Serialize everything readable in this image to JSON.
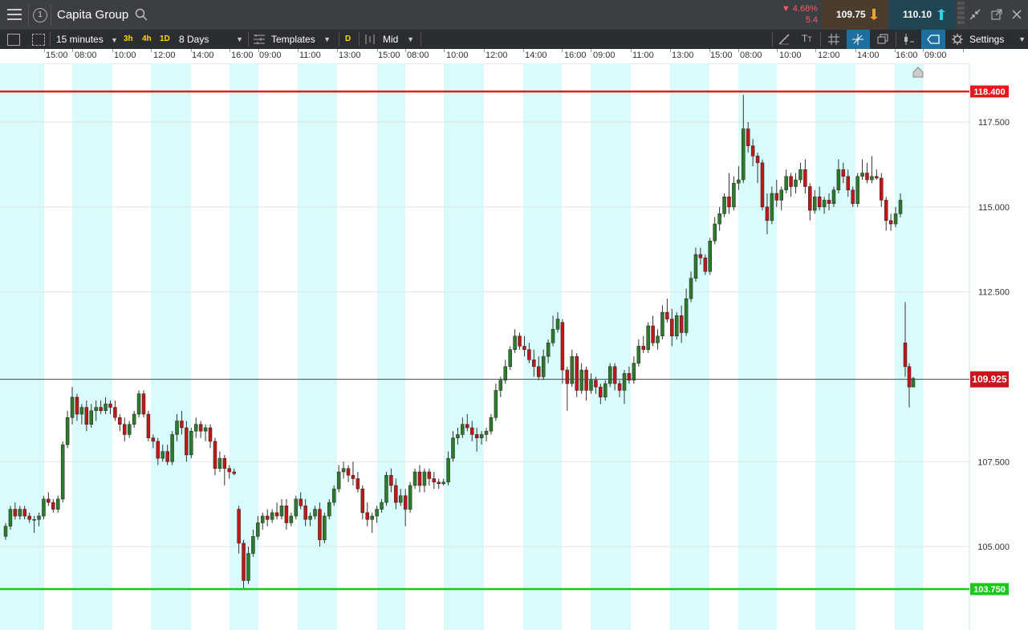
{
  "header": {
    "instrument": "Capita Group",
    "change_pct": "▼ 4.68%",
    "change_abs": "5.4",
    "sell_price": "109.75",
    "buy_price": "110.10",
    "colors": {
      "down": "#ff5a5a",
      "sell_bg": "#4a3a2a",
      "buy_bg": "#1e4a5a",
      "arrow_sell": "#f0a030",
      "arrow_buy": "#3cc8e8"
    }
  },
  "toolbar": {
    "interval": "15 minutes",
    "quick_ranges": [
      "3h",
      "4h",
      "1D"
    ],
    "period": "8 Days",
    "templates": "Templates",
    "d_label": "D",
    "price_type": "Mid",
    "settings": "Settings"
  },
  "chart_data": {
    "type": "candlestick",
    "x_tick_labels": [
      "15:00",
      "08:00",
      "10:00",
      "12:00",
      "14:00",
      "16:00",
      "09:00",
      "11:00",
      "13:00",
      "15:00",
      "08:00",
      "10:00",
      "12:00",
      "14:00",
      "16:00",
      "09:00",
      "11:00",
      "13:00",
      "15:00",
      "08:00",
      "10:00",
      "12:00",
      "14:00",
      "16:00",
      "09:00"
    ],
    "y_tick_labels": [
      "117.500",
      "115.000",
      "112.500",
      "107.500",
      "105.000"
    ],
    "y_ticks": [
      117.5,
      115.0,
      112.5,
      107.5,
      105.0
    ],
    "ylim": [
      102.6,
      119.2
    ],
    "horizontal_lines": [
      {
        "value": 118.4,
        "label": "118.400",
        "color": "#e8191e"
      },
      {
        "value": 109.925,
        "label": "109.925",
        "color": "#444444",
        "box_color": "#c8161d"
      },
      {
        "value": 103.75,
        "label": "103.750",
        "color": "#19c819"
      }
    ],
    "colors": {
      "up": "#2d7a2d",
      "down": "#c01818",
      "session_band": "#d9fbfc"
    },
    "candles": [
      [
        105.3,
        105.7,
        105.2,
        105.6
      ],
      [
        105.6,
        106.2,
        105.5,
        106.1
      ],
      [
        106.1,
        106.3,
        105.8,
        105.9
      ],
      [
        105.9,
        106.2,
        105.8,
        106.1
      ],
      [
        106.1,
        106.2,
        105.8,
        105.9
      ],
      [
        105.9,
        106.0,
        105.7,
        105.8
      ],
      [
        105.8,
        105.9,
        105.4,
        105.8
      ],
      [
        105.8,
        106.0,
        105.6,
        105.9
      ],
      [
        105.9,
        106.5,
        105.8,
        106.4
      ],
      [
        106.4,
        106.6,
        106.2,
        106.3
      ],
      [
        106.3,
        106.4,
        106.0,
        106.1
      ],
      [
        106.1,
        106.5,
        106.0,
        106.4
      ],
      [
        106.4,
        108.1,
        106.3,
        108.0
      ],
      [
        108.0,
        109.0,
        107.9,
        108.8
      ],
      [
        108.8,
        109.7,
        108.6,
        109.4
      ],
      [
        109.4,
        109.5,
        108.7,
        108.9
      ],
      [
        108.9,
        109.2,
        108.6,
        109.1
      ],
      [
        109.1,
        109.3,
        108.4,
        108.6
      ],
      [
        108.6,
        109.2,
        108.5,
        109.0
      ],
      [
        109.0,
        109.3,
        108.7,
        109.1
      ],
      [
        109.1,
        109.3,
        108.9,
        109.0
      ],
      [
        109.0,
        109.4,
        108.9,
        109.2
      ],
      [
        109.2,
        109.3,
        108.9,
        109.1
      ],
      [
        109.1,
        109.3,
        108.7,
        108.8
      ],
      [
        108.8,
        108.9,
        108.4,
        108.6
      ],
      [
        108.6,
        108.8,
        108.1,
        108.3
      ],
      [
        108.3,
        108.7,
        108.2,
        108.6
      ],
      [
        108.6,
        109.0,
        108.5,
        108.9
      ],
      [
        108.9,
        109.6,
        108.8,
        109.5
      ],
      [
        109.5,
        109.6,
        108.8,
        108.9
      ],
      [
        108.9,
        109.0,
        108.1,
        108.2
      ],
      [
        108.2,
        108.3,
        107.9,
        108.1
      ],
      [
        108.1,
        108.2,
        107.4,
        107.6
      ],
      [
        107.6,
        108.0,
        107.5,
        107.8
      ],
      [
        107.8,
        108.0,
        107.4,
        107.5
      ],
      [
        107.5,
        108.4,
        107.4,
        108.3
      ],
      [
        108.3,
        108.9,
        108.1,
        108.7
      ],
      [
        108.7,
        109.0,
        108.3,
        108.5
      ],
      [
        108.5,
        108.7,
        107.5,
        107.7
      ],
      [
        107.7,
        108.5,
        107.6,
        108.4
      ],
      [
        108.4,
        108.8,
        108.2,
        108.6
      ],
      [
        108.6,
        108.7,
        108.2,
        108.4
      ],
      [
        108.4,
        108.6,
        108.1,
        108.5
      ],
      [
        108.5,
        108.6,
        107.9,
        108.1
      ],
      [
        108.1,
        108.2,
        107.1,
        107.3
      ],
      [
        107.3,
        107.8,
        107.2,
        107.6
      ],
      [
        107.6,
        107.7,
        106.8,
        107.3
      ],
      [
        107.3,
        107.4,
        107.0,
        107.2
      ],
      [
        107.2,
        107.3,
        107.1,
        107.15
      ],
      [
        106.1,
        106.2,
        104.8,
        105.1
      ],
      [
        105.1,
        105.2,
        103.75,
        104.0
      ],
      [
        104.0,
        105.0,
        103.9,
        104.8
      ],
      [
        104.8,
        105.5,
        104.7,
        105.3
      ],
      [
        105.3,
        105.9,
        105.2,
        105.7
      ],
      [
        105.7,
        106.0,
        105.5,
        105.9
      ],
      [
        105.9,
        106.1,
        105.6,
        105.8
      ],
      [
        105.8,
        106.1,
        105.7,
        106.0
      ],
      [
        106.0,
        106.3,
        105.8,
        105.9
      ],
      [
        105.9,
        106.4,
        105.8,
        106.2
      ],
      [
        106.2,
        106.4,
        105.5,
        105.7
      ],
      [
        105.7,
        106.0,
        105.6,
        105.9
      ],
      [
        105.9,
        106.5,
        105.8,
        106.4
      ],
      [
        106.4,
        106.6,
        106.1,
        106.2
      ],
      [
        106.2,
        106.4,
        105.6,
        105.8
      ],
      [
        105.8,
        106.0,
        105.6,
        105.9
      ],
      [
        105.9,
        106.2,
        105.8,
        106.1
      ],
      [
        106.1,
        106.3,
        105.0,
        105.2
      ],
      [
        105.2,
        106.0,
        105.1,
        105.9
      ],
      [
        105.9,
        106.4,
        105.8,
        106.3
      ],
      [
        106.3,
        106.8,
        106.2,
        106.7
      ],
      [
        106.7,
        107.4,
        106.6,
        107.2
      ],
      [
        107.2,
        107.5,
        107.0,
        107.3
      ],
      [
        107.3,
        107.4,
        106.9,
        107.1
      ],
      [
        107.1,
        107.5,
        106.8,
        107.0
      ],
      [
        107.0,
        107.2,
        106.6,
        106.7
      ],
      [
        106.7,
        106.8,
        105.8,
        106.0
      ],
      [
        106.0,
        106.3,
        105.6,
        105.8
      ],
      [
        105.8,
        106.0,
        105.4,
        105.9
      ],
      [
        105.9,
        106.2,
        105.7,
        106.1
      ],
      [
        106.1,
        106.4,
        106.0,
        106.3
      ],
      [
        106.3,
        107.2,
        106.2,
        107.1
      ],
      [
        107.1,
        107.3,
        106.6,
        106.8
      ],
      [
        106.8,
        107.0,
        106.1,
        106.3
      ],
      [
        106.3,
        106.7,
        106.2,
        106.5
      ],
      [
        106.5,
        106.7,
        105.6,
        106.1
      ],
      [
        106.1,
        106.9,
        106.0,
        106.8
      ],
      [
        106.8,
        107.3,
        106.7,
        107.2
      ],
      [
        107.2,
        107.4,
        106.6,
        106.8
      ],
      [
        106.8,
        107.3,
        106.6,
        107.2
      ],
      [
        107.2,
        107.3,
        106.8,
        107.0
      ],
      [
        107.0,
        107.2,
        106.7,
        106.9
      ],
      [
        106.9,
        107.0,
        106.7,
        106.85
      ],
      [
        106.85,
        107.0,
        106.8,
        106.9
      ],
      [
        106.9,
        107.8,
        106.8,
        107.6
      ],
      [
        107.6,
        108.4,
        107.5,
        108.2
      ],
      [
        108.2,
        108.5,
        108.0,
        108.3
      ],
      [
        108.3,
        108.8,
        108.2,
        108.6
      ],
      [
        108.6,
        108.9,
        108.4,
        108.5
      ],
      [
        108.5,
        108.7,
        108.1,
        108.3
      ],
      [
        108.3,
        108.5,
        107.8,
        108.2
      ],
      [
        108.2,
        108.4,
        108.0,
        108.3
      ],
      [
        108.3,
        108.5,
        108.1,
        108.4
      ],
      [
        108.4,
        108.9,
        108.3,
        108.8
      ],
      [
        108.8,
        109.8,
        108.7,
        109.6
      ],
      [
        109.6,
        110.0,
        109.4,
        109.9
      ],
      [
        109.9,
        110.5,
        109.8,
        110.3
      ],
      [
        110.3,
        110.9,
        110.2,
        110.8
      ],
      [
        110.8,
        111.4,
        110.7,
        111.2
      ],
      [
        111.2,
        111.3,
        110.8,
        110.9
      ],
      [
        110.9,
        111.2,
        110.6,
        110.8
      ],
      [
        110.8,
        111.0,
        110.4,
        110.5
      ],
      [
        110.5,
        110.8,
        110.0,
        110.3
      ],
      [
        110.3,
        110.6,
        109.9,
        110.0
      ],
      [
        110.0,
        110.8,
        109.9,
        110.6
      ],
      [
        110.6,
        111.1,
        110.4,
        111.0
      ],
      [
        111.0,
        111.8,
        110.9,
        111.4
      ],
      [
        111.4,
        111.9,
        111.3,
        111.7
      ],
      [
        111.6,
        111.7,
        109.8,
        110.2
      ],
      [
        110.2,
        110.3,
        109.0,
        109.8
      ],
      [
        109.8,
        110.8,
        109.7,
        110.6
      ],
      [
        110.6,
        110.7,
        109.4,
        109.6
      ],
      [
        109.6,
        110.4,
        109.5,
        110.2
      ],
      [
        110.2,
        110.3,
        109.3,
        109.6
      ],
      [
        109.6,
        110.1,
        109.5,
        109.9
      ],
      [
        109.9,
        110.0,
        109.5,
        109.7
      ],
      [
        109.7,
        109.8,
        109.2,
        109.4
      ],
      [
        109.4,
        109.9,
        109.3,
        109.8
      ],
      [
        109.8,
        110.4,
        109.7,
        110.3
      ],
      [
        110.3,
        110.4,
        109.6,
        109.8
      ],
      [
        109.8,
        109.9,
        109.4,
        109.6
      ],
      [
        109.6,
        110.2,
        109.2,
        110.1
      ],
      [
        110.1,
        110.3,
        109.8,
        109.9
      ],
      [
        109.9,
        110.6,
        109.8,
        110.4
      ],
      [
        110.4,
        111.1,
        110.3,
        110.9
      ],
      [
        110.9,
        111.2,
        110.7,
        110.8
      ],
      [
        110.8,
        111.6,
        110.7,
        111.5
      ],
      [
        111.5,
        111.8,
        110.9,
        111.0
      ],
      [
        111.0,
        111.4,
        110.8,
        111.2
      ],
      [
        111.2,
        112.1,
        111.1,
        111.9
      ],
      [
        111.9,
        112.3,
        111.6,
        111.7
      ],
      [
        111.7,
        112.0,
        110.9,
        111.2
      ],
      [
        111.2,
        111.9,
        111.1,
        111.8
      ],
      [
        111.8,
        112.1,
        111.0,
        111.3
      ],
      [
        111.3,
        112.6,
        111.2,
        112.3
      ],
      [
        112.3,
        113.1,
        112.2,
        112.9
      ],
      [
        112.9,
        113.8,
        112.8,
        113.6
      ],
      [
        113.6,
        113.8,
        113.3,
        113.5
      ],
      [
        113.5,
        113.6,
        113.0,
        113.1
      ],
      [
        113.1,
        114.1,
        113.0,
        114.0
      ],
      [
        114.0,
        114.7,
        113.9,
        114.5
      ],
      [
        114.5,
        115.0,
        114.3,
        114.8
      ],
      [
        114.8,
        115.4,
        114.7,
        115.3
      ],
      [
        115.3,
        116.0,
        114.8,
        115.0
      ],
      [
        115.0,
        115.9,
        114.9,
        115.7
      ],
      [
        115.7,
        116.2,
        115.5,
        115.8
      ],
      [
        115.8,
        118.3,
        115.7,
        117.3
      ],
      [
        117.3,
        117.5,
        116.6,
        116.8
      ],
      [
        116.8,
        117.0,
        116.2,
        116.5
      ],
      [
        116.5,
        116.6,
        115.7,
        116.3
      ],
      [
        116.3,
        116.4,
        114.9,
        115.0
      ],
      [
        115.0,
        115.4,
        114.2,
        114.6
      ],
      [
        114.6,
        115.6,
        114.5,
        115.4
      ],
      [
        115.4,
        115.8,
        115.0,
        115.2
      ],
      [
        115.2,
        115.6,
        114.9,
        115.5
      ],
      [
        115.5,
        116.1,
        115.4,
        115.9
      ],
      [
        115.9,
        116.0,
        115.3,
        115.6
      ],
      [
        115.6,
        116.0,
        115.4,
        115.8
      ],
      [
        115.8,
        116.3,
        115.7,
        116.1
      ],
      [
        116.1,
        116.4,
        115.4,
        115.6
      ],
      [
        115.6,
        115.7,
        114.6,
        114.9
      ],
      [
        114.9,
        115.5,
        114.8,
        115.3
      ],
      [
        115.3,
        115.6,
        114.9,
        115.0
      ],
      [
        115.0,
        115.3,
        114.8,
        115.2
      ],
      [
        115.2,
        115.4,
        114.9,
        115.1
      ],
      [
        115.1,
        115.6,
        115.0,
        115.5
      ],
      [
        115.5,
        116.4,
        115.4,
        116.1
      ],
      [
        116.1,
        116.3,
        115.7,
        115.9
      ],
      [
        115.9,
        116.1,
        115.3,
        115.5
      ],
      [
        115.5,
        115.6,
        115.0,
        115.1
      ],
      [
        115.1,
        116.0,
        115.0,
        115.9
      ],
      [
        115.9,
        116.4,
        115.8,
        116.0
      ],
      [
        116.0,
        116.3,
        115.7,
        115.8
      ],
      [
        115.8,
        116.5,
        115.7,
        115.9
      ],
      [
        115.9,
        116.1,
        115.8,
        115.85
      ],
      [
        115.85,
        116.0,
        115.0,
        115.2
      ],
      [
        115.2,
        115.3,
        114.3,
        114.6
      ],
      [
        114.6,
        114.8,
        114.3,
        114.5
      ],
      [
        114.5,
        115.0,
        114.4,
        114.8
      ],
      [
        114.8,
        115.4,
        114.7,
        115.2
      ],
      [
        111.0,
        112.2,
        110.0,
        110.3
      ],
      [
        110.3,
        110.4,
        109.1,
        109.7
      ],
      [
        109.7,
        110.0,
        109.8,
        109.95
      ]
    ]
  }
}
